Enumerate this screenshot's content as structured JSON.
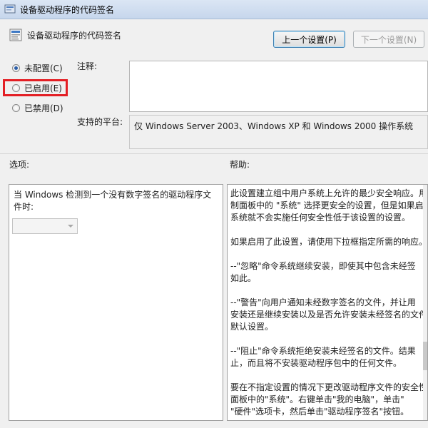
{
  "window": {
    "title": "设备驱动程序的代码签名",
    "icon": "policy-window-icon"
  },
  "header": {
    "title": "设备驱动程序的代码签名",
    "icon": "policy-setting-icon"
  },
  "nav": {
    "prev_label": "上一个设置(P)",
    "next_label": "下一个设置(N)"
  },
  "state": {
    "selected": "not_configured",
    "options": [
      {
        "id": "not_configured",
        "label": "未配置(C)"
      },
      {
        "id": "enabled",
        "label": "已启用(E)"
      },
      {
        "id": "disabled",
        "label": "已禁用(D)"
      }
    ]
  },
  "labels": {
    "comment": "注释:",
    "platform": "支持的平台:",
    "options": "选项:",
    "help": "帮助:"
  },
  "comment_value": "",
  "platform_value": "仅 Windows Server 2003、Windows XP 和 Windows 2000 操作系统",
  "options_panel": {
    "line1": "当 Windows 检测到一个没有数字签名的驱动程序文",
    "line2": "件时:",
    "dropdown_value": ""
  },
  "help_text": [
    "此设置建立组中用户系统上允许的最少安全响应。用",
    "制面板中的 \"系统\" 选择更安全的设置，但是如果启",
    "系统就不会实施任何安全性低于该设置的设置。",
    "",
    "如果启用了此设置，请使用下拉框指定所需的响应。",
    "",
    "--\"忽略\"命令系统继续安装，即使其中包含未经签",
    "如此。",
    "",
    "--\"警告\"向用户通知未经数字签名的文件，并让用",
    "安装还是继续安装以及是否允许安装未经签名的文件",
    "默认设置。",
    "",
    "--\"阻止\"命令系统拒绝安装未经签名的文件。结果",
    "止，而且将不安装驱动程序包中的任何文件。",
    "",
    "要在不指定设置的情况下更改驱动程序文件的安全性",
    "面板中的\"系统\"。右键单击\"我的电脑\"，单击\"",
    "\"硬件\"选项卡，然后单击\"驱动程序签名\"按钮。"
  ],
  "colors": {
    "highlight_border": "#e31e24",
    "radio_selected": "#2a5da8"
  }
}
